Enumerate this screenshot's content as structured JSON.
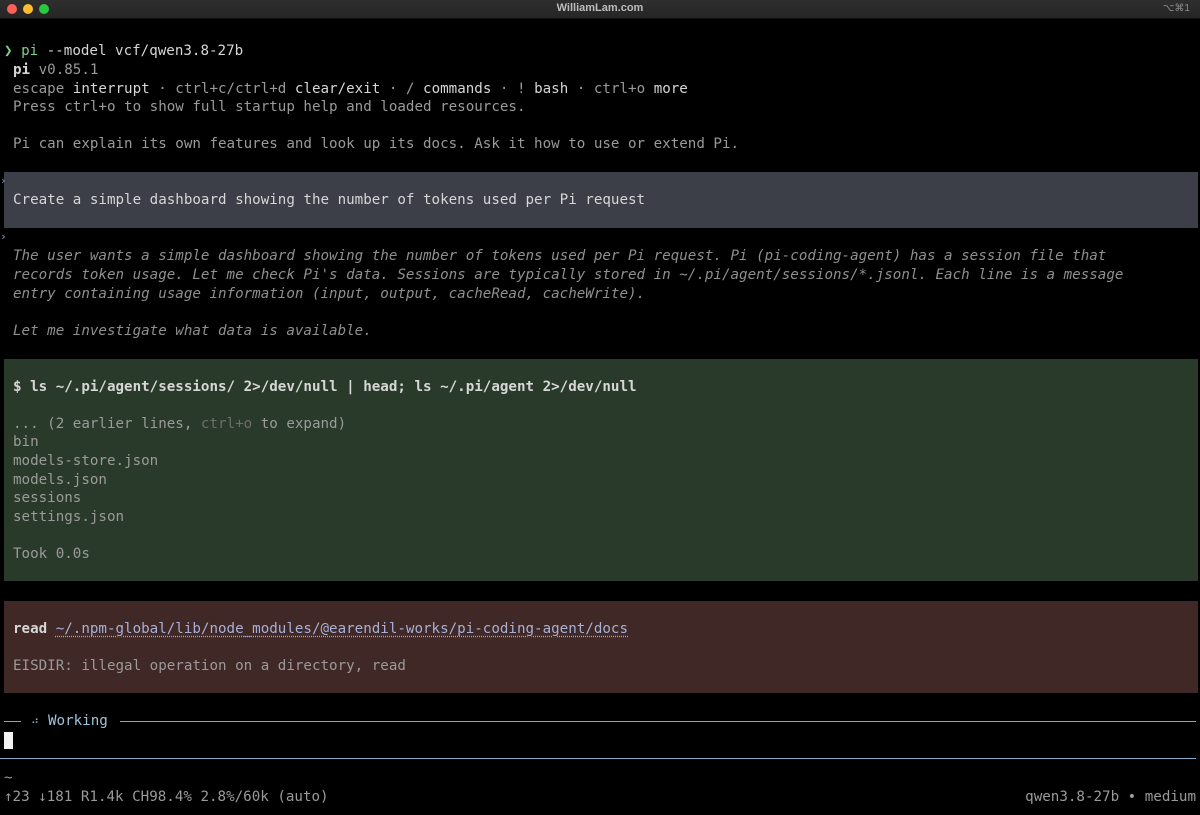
{
  "window": {
    "title": "WilliamLam.com",
    "shortcut": "⌥⌘1",
    "colors": {
      "close": "#fe5f57",
      "minimize": "#febc2e",
      "zoom": "#28c840"
    }
  },
  "prompt": {
    "symbol": "❯",
    "command": "pi",
    "args": " --model vcf/qwen3.8-27b"
  },
  "startup": {
    "name": "pi",
    "version": " v0.85.1",
    "keys": [
      {
        "key": "escape ",
        "action": "interrupt"
      },
      {
        "key": " · ctrl+c/ctrl+d ",
        "action": "clear/exit"
      },
      {
        "key": " · / ",
        "action": "commands"
      },
      {
        "key": " · ! ",
        "action": "bash"
      },
      {
        "key": " · ctrl+o ",
        "action": "more"
      }
    ],
    "help_line": "Press ctrl+o to show full startup help and loaded resources.",
    "intro": "Pi can explain its own features and look up its docs. Ask it how to use or extend Pi."
  },
  "user_message": "Create a simple dashboard showing the number of tokens used per Pi request",
  "thinking": {
    "lines": [
      "The user wants a simple dashboard showing the number of tokens used per Pi request. Pi (pi-coding-agent) has a session file that",
      "records token usage. Let me check Pi's data. Sessions are typically stored in ~/.pi/agent/sessions/*.jsonl. Each line is a message",
      "entry containing usage information (input, output, cacheRead, cacheWrite)."
    ],
    "followup": "Let me investigate what data is available."
  },
  "bash_tool": {
    "command": "$ ls ~/.pi/agent/sessions/ 2>/dev/null | head; ls ~/.pi/agent 2>/dev/null",
    "collapsed_prefix": "... (2 earlier lines, ",
    "collapsed_key": "ctrl+o",
    "collapsed_suffix": " to expand)",
    "output": [
      "bin",
      "models-store.json",
      "models.json",
      "sessions",
      "settings.json"
    ],
    "timing": "Took 0.0s"
  },
  "read_tool": {
    "label": "read",
    "path": "~/.npm-global/lib/node_modules/@earendil-works/pi-coding-agent/docs",
    "error": "EISDIR: illegal operation on a directory, read"
  },
  "status": {
    "spinner": "⠴",
    "text": "Working"
  },
  "footer": {
    "cwd": "~",
    "stats": "↑23 ↓181 R1.4k CH98.4% 2.8%/60k (auto)",
    "model": "qwen3.8-27b • medium"
  }
}
